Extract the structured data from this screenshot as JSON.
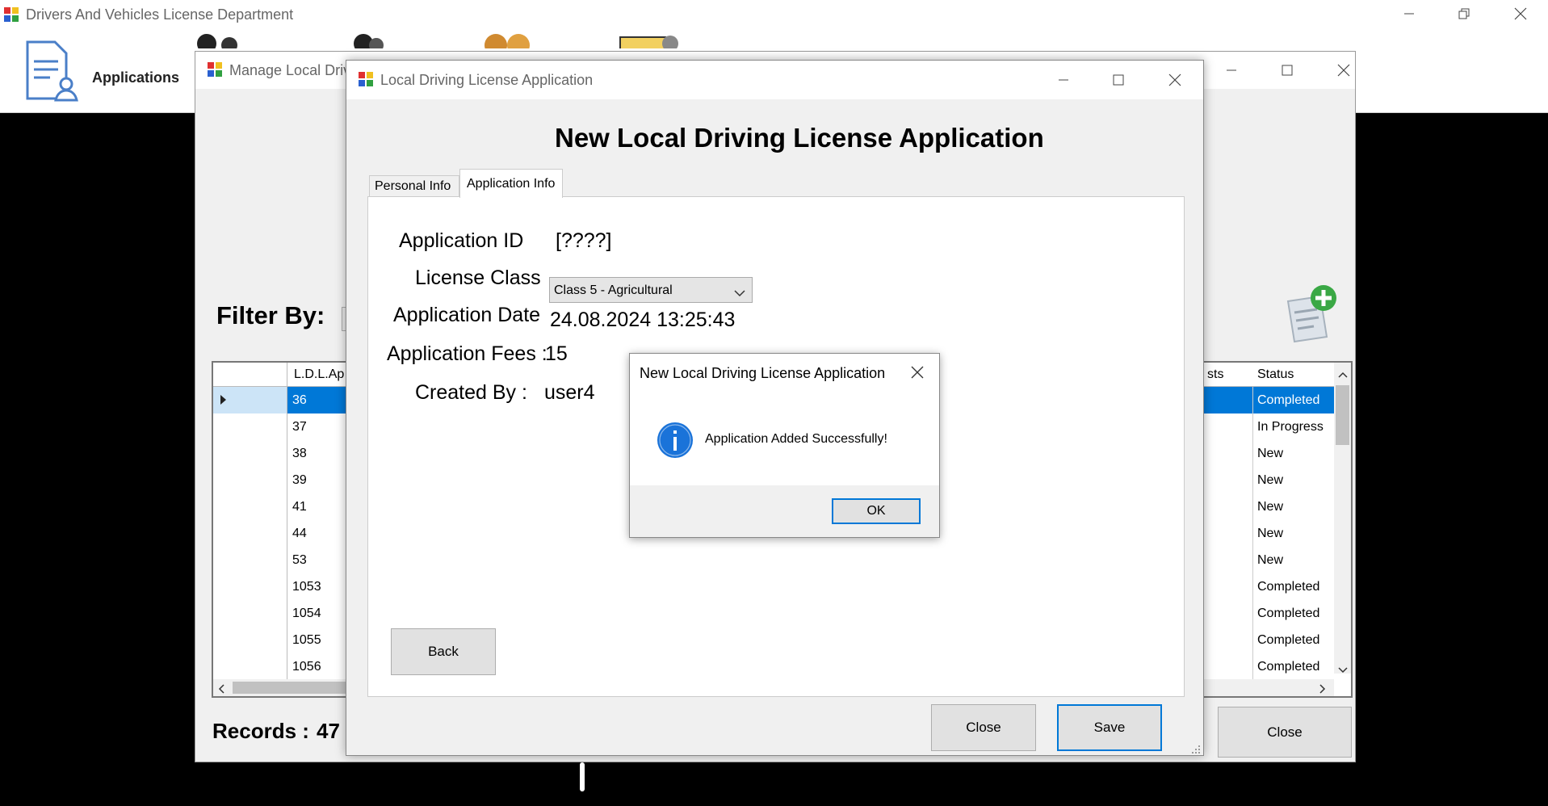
{
  "main_window": {
    "title": "Drivers And Vehicles License Department",
    "toolbar": {
      "applications_label": "Applications"
    }
  },
  "manage_window": {
    "title": "Manage Local Driv",
    "filter_label": "Filter By:",
    "grid": {
      "headers": [
        "L.D.L.Ap",
        "sts",
        "Status"
      ],
      "rows": [
        {
          "id": "36",
          "status": "Completed"
        },
        {
          "id": "37",
          "status": "In Progress"
        },
        {
          "id": "38",
          "status": "New"
        },
        {
          "id": "39",
          "status": "New"
        },
        {
          "id": "41",
          "status": "New"
        },
        {
          "id": "44",
          "status": "New"
        },
        {
          "id": "53",
          "status": "New"
        },
        {
          "id": "1053",
          "status": "Completed"
        },
        {
          "id": "1054",
          "status": "Completed"
        },
        {
          "id": "1055",
          "status": "Completed"
        },
        {
          "id": "1056",
          "status": "Completed"
        }
      ]
    },
    "records_label": "Records :",
    "records_count": "47",
    "close_label": "Close"
  },
  "app_dialog": {
    "title": "Local Driving License Application",
    "heading": "New Local Driving License Application",
    "tabs": [
      "Personal Info",
      "Application Info"
    ],
    "application_id_label": "Application ID",
    "application_id_value": "[????]",
    "license_class_label": "License Class",
    "license_class_value": "Class 5 - Agricultural",
    "application_date_label": "Application Date",
    "application_date_value": "24.08.2024 13:25:43",
    "fees_label": "Application Fees :",
    "fees_value": "15",
    "created_by_label": "Created By :",
    "created_by_value": "user4",
    "back_label": "Back",
    "close_label": "Close",
    "save_label": "Save"
  },
  "message_box": {
    "title": "New Local Driving License Application",
    "message": "Application Added Successfully!",
    "ok_label": "OK",
    "icon": "info-icon"
  },
  "colors": {
    "selection": "#0078d7",
    "accent_blue": "#0078d7",
    "info_icon": "#1a73d9",
    "dark_background": "#000000"
  }
}
